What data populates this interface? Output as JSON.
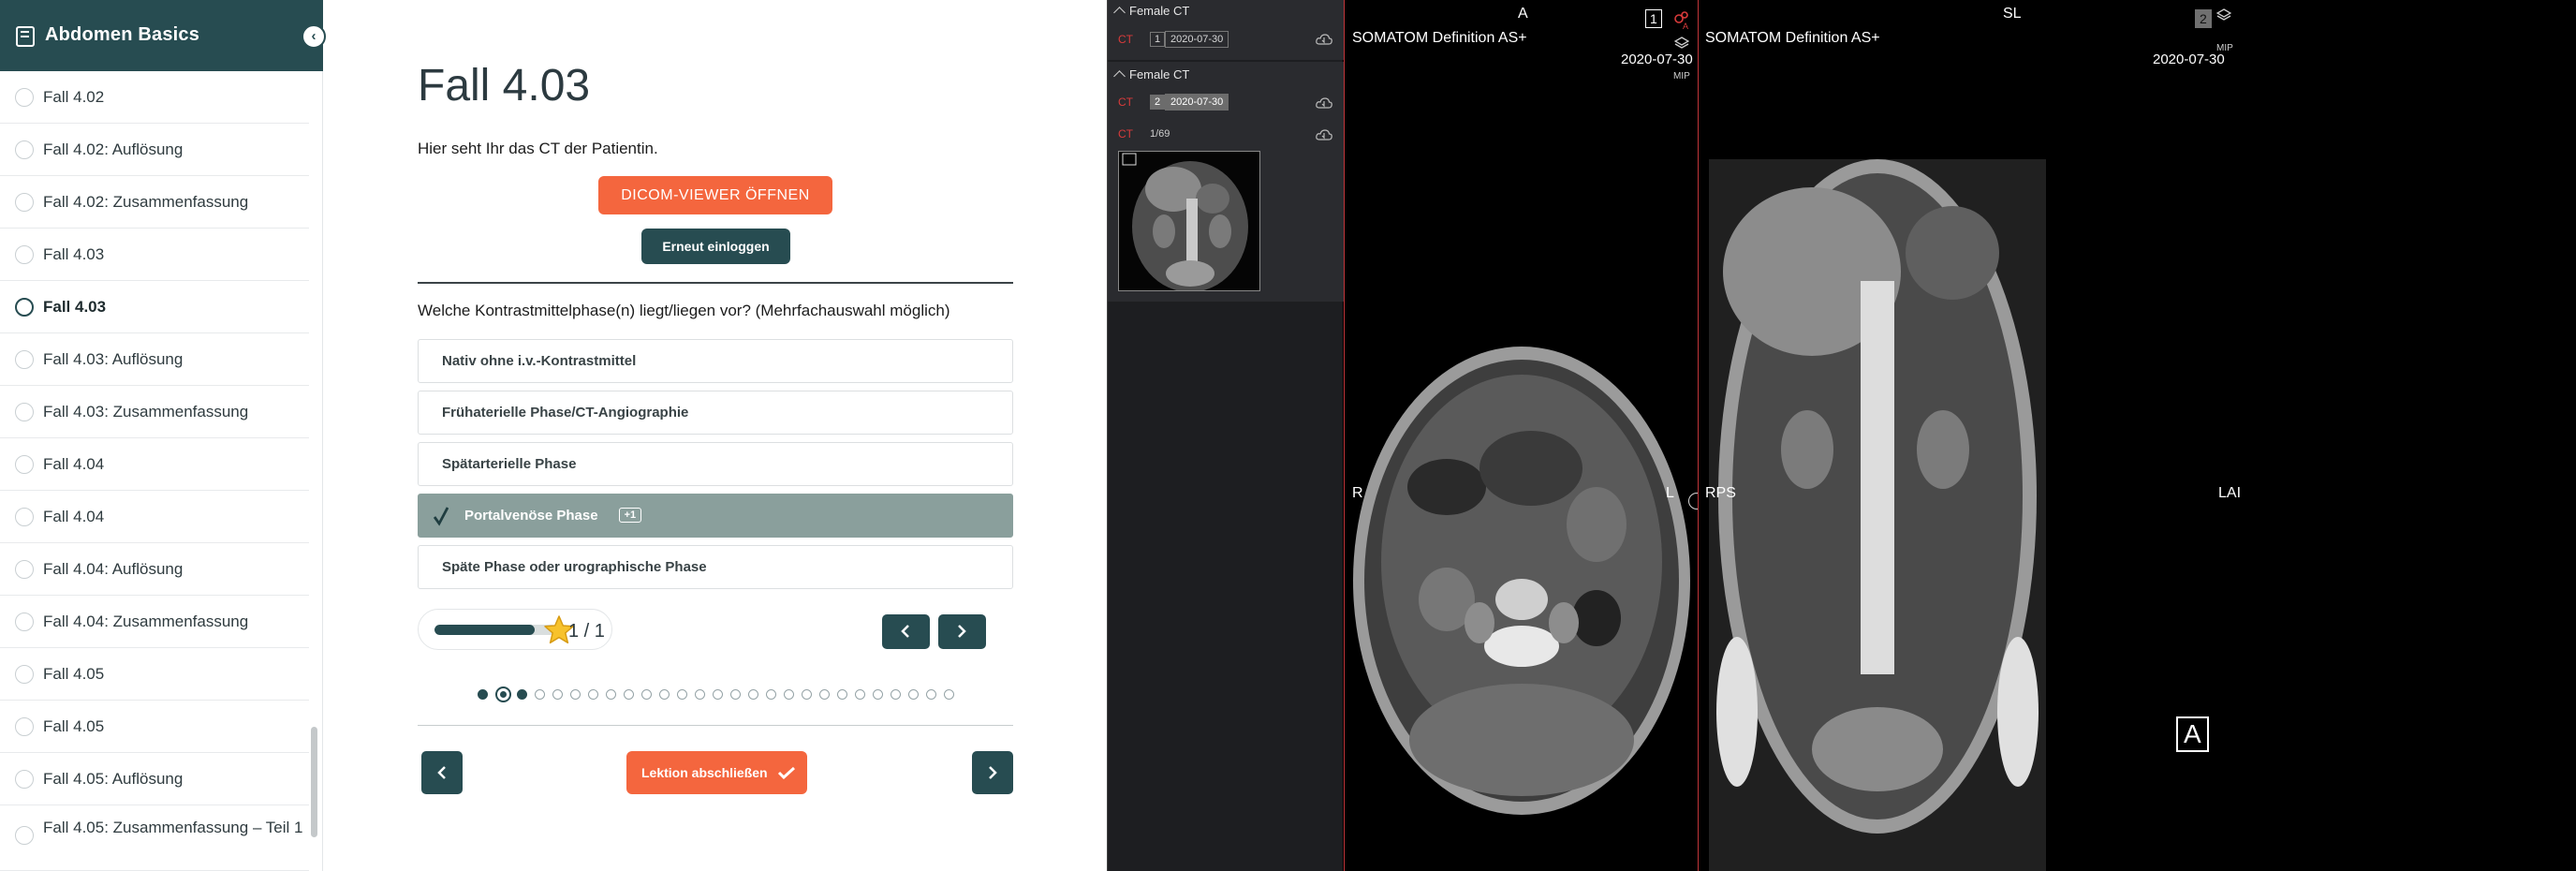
{
  "sidebar": {
    "title": "Abdomen Basics",
    "collapse_icon": "‹",
    "items": [
      {
        "label": "Fall 4.02",
        "active": false
      },
      {
        "label": "Fall 4.02: Auflösung",
        "active": false
      },
      {
        "label": "Fall 4.02: Zusammenfassung",
        "active": false
      },
      {
        "label": "Fall 4.03",
        "active": false
      },
      {
        "label": "Fall 4.03",
        "active": true
      },
      {
        "label": "Fall 4.03: Auflösung",
        "active": false
      },
      {
        "label": "Fall 4.03: Zusammenfassung",
        "active": false
      },
      {
        "label": "Fall 4.04",
        "active": false
      },
      {
        "label": "Fall 4.04",
        "active": false
      },
      {
        "label": "Fall 4.04: Auflösung",
        "active": false
      },
      {
        "label": "Fall 4.04: Zusammenfassung",
        "active": false
      },
      {
        "label": "Fall 4.05",
        "active": false
      },
      {
        "label": "Fall 4.05",
        "active": false
      },
      {
        "label": "Fall 4.05: Auflösung",
        "active": false
      },
      {
        "label": "Fall 4.05: Zusammenfassung – Teil 1",
        "active": false
      }
    ]
  },
  "lesson": {
    "title": "Fall 4.03",
    "intro": "Hier seht Ihr das CT der Patientin.",
    "dicom_button": "DICOM-VIEWER ÖFFNEN",
    "login_button": "Erneut einloggen",
    "question": "Welche Kontrastmittelphase(n) liegt/liegen vor? (Mehrfachauswahl möglich)",
    "options": [
      {
        "label": "Nativ ohne i.v.-Kontrastmittel",
        "selected": false
      },
      {
        "label": "Frühaterielle Phase/CT-Angiographie",
        "selected": false
      },
      {
        "label": "Spätarterielle Phase",
        "selected": false
      },
      {
        "label": "Portalvenöse Phase",
        "selected": true,
        "badge": "+1"
      },
      {
        "label": "Späte Phase oder urographische Phase",
        "selected": false
      }
    ],
    "progress": 0.82,
    "score": "1 / 1",
    "pagination": {
      "total": 27,
      "current": 2,
      "completed": [
        1,
        3
      ]
    },
    "finish_button": "Lektion abschließen"
  },
  "viewer": {
    "studies": [
      {
        "title": "Female CT",
        "modality": "CT",
        "index": "1",
        "date": "2020-07-30",
        "highlight": false
      },
      {
        "title": "Female CT",
        "modality": "CT",
        "index": "2",
        "date": "2020-07-30",
        "highlight": true,
        "series_modality": "CT",
        "series_count": "1/69"
      }
    ],
    "viewport_axial": {
      "scanner": "SOMATOM Definition AS+",
      "date": "2020-07-30",
      "top": "A",
      "left": "R",
      "right": "L",
      "index": "1",
      "mip": "MIP"
    },
    "viewport_coronal": {
      "scanner": "SOMATOM Definition AS+",
      "date": "2020-07-30",
      "top": "SL",
      "left": "RPS",
      "right": "LAI",
      "index": "2",
      "mip": "MIP",
      "marker": "A"
    }
  },
  "colors": {
    "brand_dark": "#274c51",
    "accent_orange": "#f4663e",
    "selected_option": "#8a9f9c",
    "viewer_active": "#c0353a"
  }
}
